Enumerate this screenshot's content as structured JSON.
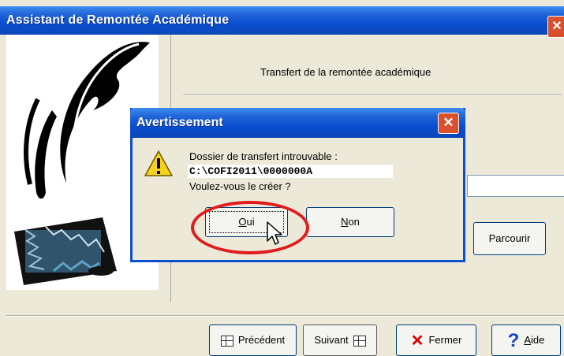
{
  "window": {
    "title": "Assistant de Remontée Académique",
    "close_glyph": "✕"
  },
  "main": {
    "heading": "Transfert de la remontée académique",
    "browse_label": "Parcourir"
  },
  "footer": {
    "prev_label": "Précédent",
    "next_label": "Suivant",
    "close_label": "Fermer",
    "help_label": "Aide"
  },
  "dialog": {
    "title": "Avertissement",
    "close_glyph": "✕",
    "message_line1": "Dossier de transfert introuvable :",
    "path": "C:\\COFI2011\\0000000A",
    "message_line3": "Voulez-vous le créer ?",
    "yes_label": "Oui",
    "no_label": "Non"
  },
  "colors": {
    "titlebar": "#0a4fd0",
    "close_button": "#d8502c",
    "highlight_oval": "#e11c1c",
    "warning_icon": "#f5d21c"
  },
  "icons": {
    "warning": "warning-icon",
    "prev": "prev-icon",
    "next": "next-icon",
    "close": "close-x-icon",
    "help": "help-question-icon"
  }
}
